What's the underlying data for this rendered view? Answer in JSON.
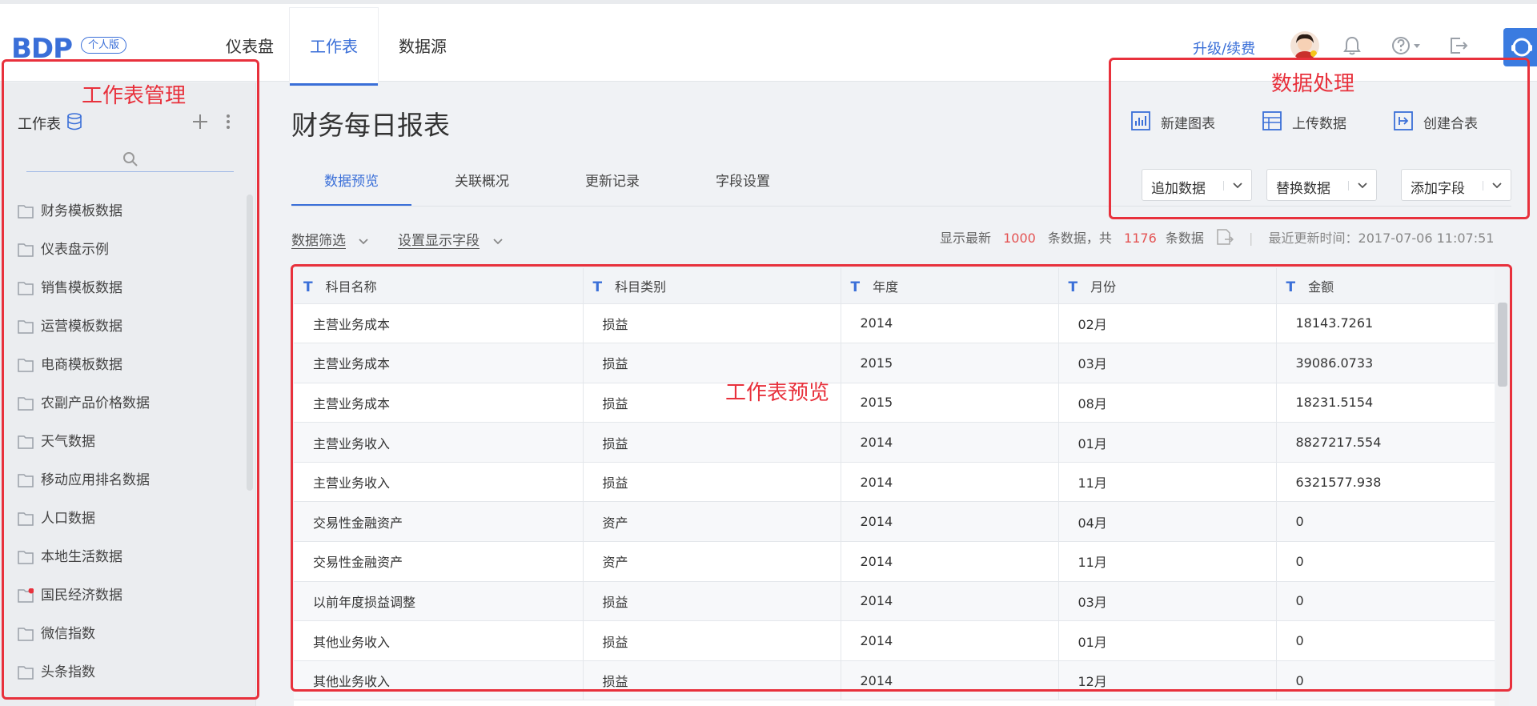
{
  "header": {
    "logo": "BDP",
    "edition": "个人版",
    "nav": [
      {
        "label": "仪表盘"
      },
      {
        "label": "工作表"
      },
      {
        "label": "数据源"
      }
    ],
    "upgrade": "升级/续费"
  },
  "sidebar": {
    "title": "工作表",
    "folders": [
      {
        "label": "财务模板数据"
      },
      {
        "label": "仪表盘示例"
      },
      {
        "label": "销售模板数据"
      },
      {
        "label": "运营模板数据"
      },
      {
        "label": "电商模板数据"
      },
      {
        "label": "农副产品价格数据"
      },
      {
        "label": "天气数据"
      },
      {
        "label": "移动应用排名数据"
      },
      {
        "label": "人口数据"
      },
      {
        "label": "本地生活数据"
      },
      {
        "label": "国民经济数据"
      },
      {
        "label": "微信指数"
      },
      {
        "label": "头条指数"
      }
    ]
  },
  "main": {
    "title": "财务每日报表",
    "actions": [
      {
        "label": "新建图表"
      },
      {
        "label": "上传数据"
      },
      {
        "label": "创建合表"
      }
    ],
    "tabs": [
      {
        "label": "数据预览"
      },
      {
        "label": "关联概况"
      },
      {
        "label": "更新记录"
      },
      {
        "label": "字段设置"
      }
    ],
    "dropdowns": [
      {
        "label": "追加数据"
      },
      {
        "label": "替换数据"
      },
      {
        "label": "添加字段"
      }
    ],
    "filters": [
      {
        "label": "数据筛选"
      },
      {
        "label": "设置显示字段"
      }
    ],
    "stats": {
      "prefix": "显示最新",
      "shown": "1000",
      "middle": "条数据，共",
      "total": "1176",
      "suffix": "条数据",
      "updated": "最近更新时间：2017-07-06 11:07:51"
    },
    "table": {
      "type_marker": "T",
      "columns": [
        "科目名称",
        "科目类别",
        "年度",
        "月份",
        "金额"
      ],
      "rows": [
        [
          "主营业务成本",
          "损益",
          "2014",
          "02月",
          "18143.7261"
        ],
        [
          "主营业务成本",
          "损益",
          "2015",
          "03月",
          "39086.0733"
        ],
        [
          "主营业务成本",
          "损益",
          "2015",
          "08月",
          "18231.5154"
        ],
        [
          "主营业务收入",
          "损益",
          "2014",
          "01月",
          "8827217.554"
        ],
        [
          "主营业务收入",
          "损益",
          "2014",
          "11月",
          "6321577.938"
        ],
        [
          "交易性金融资产",
          "资产",
          "2014",
          "04月",
          "0"
        ],
        [
          "交易性金融资产",
          "资产",
          "2014",
          "11月",
          "0"
        ],
        [
          "以前年度损益调整",
          "损益",
          "2014",
          "03月",
          "0"
        ],
        [
          "其他业务收入",
          "损益",
          "2014",
          "01月",
          "0"
        ],
        [
          "其他业务收入",
          "损益",
          "2014",
          "12月",
          "0"
        ]
      ]
    }
  },
  "annotations": {
    "sidebar": "工作表管理",
    "actions": "数据处理",
    "table": "工作表预览",
    "color": "#e8313c"
  },
  "colors": {
    "accent": "#3a6fd8",
    "highlight_number": "#e45252"
  }
}
